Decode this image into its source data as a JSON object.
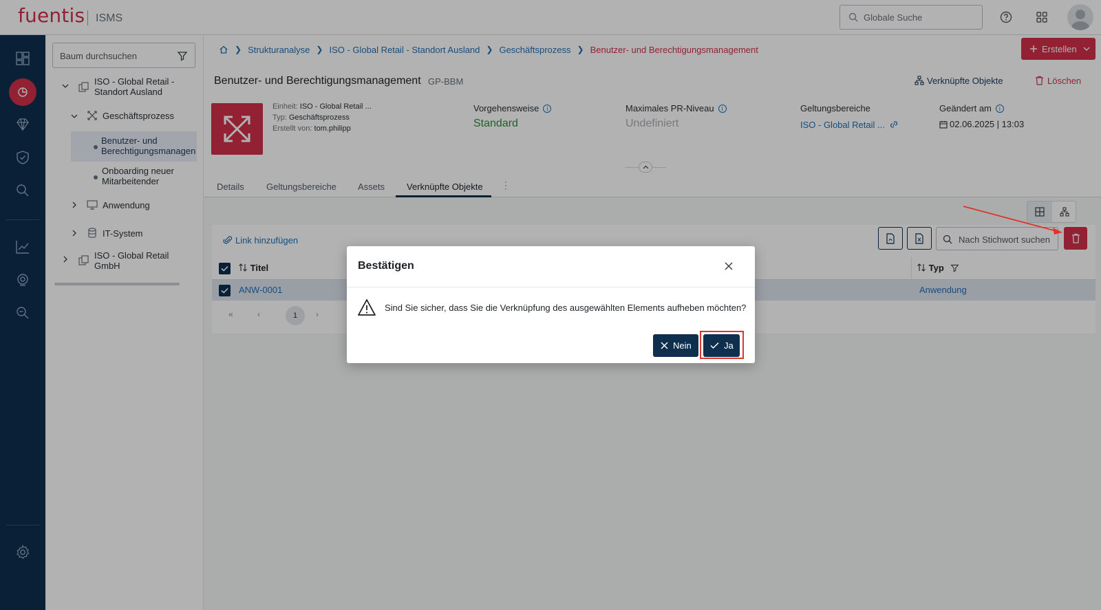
{
  "app": {
    "brand": "fuentis",
    "product": "ISMS",
    "global_search_placeholder": "Globale Suche"
  },
  "colors": {
    "brand_red": "#d0304a",
    "nav_dark": "#0f2f4f",
    "link_blue": "#1f6fb4",
    "success_green": "#2e8b3a"
  },
  "tree": {
    "search_placeholder": "Baum durchsuchen",
    "nodes": [
      {
        "label": "ISO - Global Retail - Standort Ausland",
        "icon": "organization-icon",
        "expanded": true
      },
      {
        "label": "Geschäftsprozess",
        "icon": "process-icon",
        "expanded": true
      },
      {
        "label": "Benutzer- und Berechtigungsmanagen",
        "selected": true
      },
      {
        "label": "Onboarding neuer Mitarbeitender"
      },
      {
        "label": "Anwendung",
        "icon": "monitor-icon",
        "expanded": false
      },
      {
        "label": "IT-System",
        "icon": "database-icon",
        "expanded": false
      },
      {
        "label": "ISO - Global Retail GmbH",
        "icon": "organization-icon",
        "expanded": false
      }
    ]
  },
  "breadcrumb": {
    "items": [
      "Strukturanalyse",
      "ISO - Global Retail - Standort Ausland",
      "Geschäftsprozess",
      "Benutzer- und Berechtigungsmanagement"
    ]
  },
  "header": {
    "create_label": "Erstellen",
    "title": "Benutzer- und Berechtigungsmanagement",
    "code": "GP-BBM",
    "linked_objects_label": "Verknüpfte Objekte",
    "delete_label": "Löschen",
    "meta": {
      "unit_label": "Einheit:",
      "unit_value": "ISO - Global Retail ...",
      "type_label": "Typ:",
      "type_value": "Geschäftsprozess",
      "created_label": "Erstellt von:",
      "created_value": "tom.philipp"
    },
    "kpis": {
      "approach_label": "Vorgehensweise",
      "approach_value": "Standard",
      "pr_label": "Maximales PR-Niveau",
      "pr_value": "Undefiniert",
      "scope_label": "Geltungsbereiche",
      "scope_value": "ISO - Global Retail ...",
      "changed_label": "Geändert am",
      "changed_value": "02.06.2025 | 13:03"
    }
  },
  "tabs": [
    "Details",
    "Geltungsbereiche",
    "Assets",
    "Verknüpfte Objekte"
  ],
  "active_tab": "Verknüpfte Objekte",
  "linked": {
    "add_link_label": "Link hinzufügen",
    "keyword_placeholder": "Nach Stichwort suchen",
    "columns": {
      "title": "Titel",
      "type": "Typ"
    },
    "rows": [
      {
        "title": "ANW-0001",
        "type": "Anwendung",
        "checked": true
      }
    ],
    "pager": {
      "first": "«",
      "prev": "‹",
      "current": "1",
      "next": "›"
    }
  },
  "dialog": {
    "title": "Bestätigen",
    "message": "Sind Sie sicher, dass Sie die Verknüpfung des ausgewählten Elements aufheben möchten?",
    "no_label": "Nein",
    "yes_label": "Ja"
  }
}
